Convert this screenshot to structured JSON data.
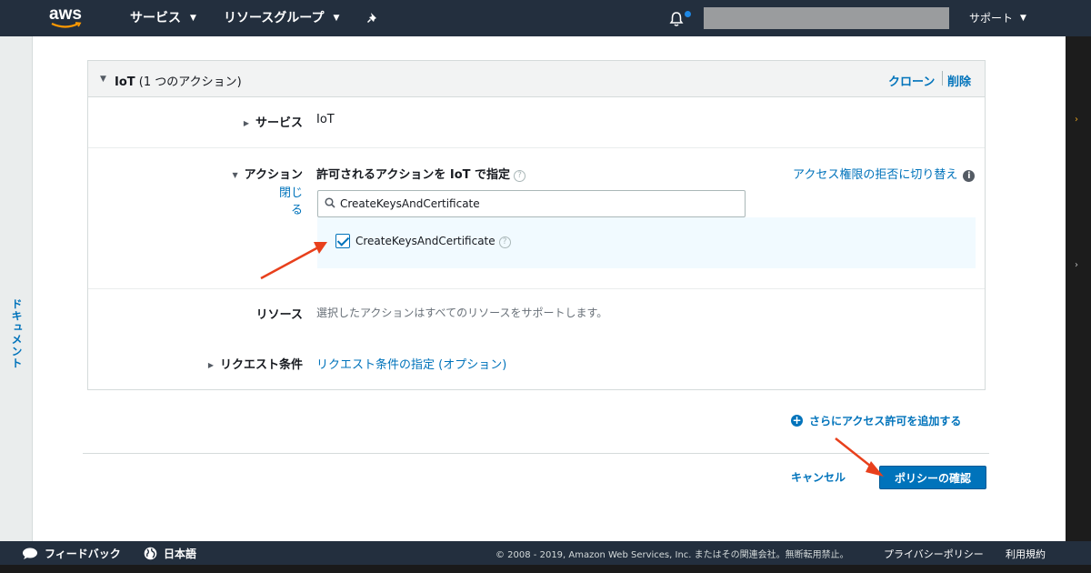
{
  "topnav": {
    "logo_text": "aws",
    "services_label": "サービス",
    "resource_groups_label": "リソースグループ",
    "support_label": "サポート"
  },
  "left_rail": {
    "doc_label": "ドキュメント"
  },
  "panel": {
    "service_name": "IoT",
    "action_count": "(1 つのアクション)",
    "clone_label": "クローン",
    "delete_label": "削除",
    "service_row": {
      "label": "サービス",
      "value": "IoT"
    },
    "action_row": {
      "label": "アクション",
      "close_link": "閉じる",
      "heading": "許可されるアクションを IoT で指定",
      "toggle_link": "アクセス権限の拒否に切り替え",
      "search_value": "CreateKeysAndCertificate",
      "results": [
        {
          "label": "CreateKeysAndCertificate",
          "checked": true
        }
      ]
    },
    "resource_row": {
      "label": "リソース",
      "value": "選択したアクションはすべてのリソースをサポートします。"
    },
    "condition_row": {
      "label": "リクエスト条件",
      "link": "リクエスト条件の指定 (オプション)"
    }
  },
  "actions": {
    "add_permission": "さらにアクセス許可を追加する",
    "cancel": "キャンセル",
    "review_policy": "ポリシーの確認"
  },
  "footer": {
    "feedback": "フィードバック",
    "language": "日本語",
    "copyright": "© 2008 - 2019, Amazon Web Services, Inc. またはその関連会社。無断転用禁止。",
    "privacy": "プライバシーポリシー",
    "terms": "利用規約"
  },
  "colors": {
    "nav_bg": "#232f3e",
    "link": "#0073bb",
    "primary_button": "#0073bb",
    "annotation_arrow": "#e8401c",
    "selected_row_bg": "#f1faff"
  },
  "icons": [
    "bell-icon",
    "pin-icon",
    "search-icon",
    "help-icon",
    "info-icon",
    "plus-circle-icon",
    "speech-bubble-icon",
    "globe-icon",
    "check-icon"
  ]
}
